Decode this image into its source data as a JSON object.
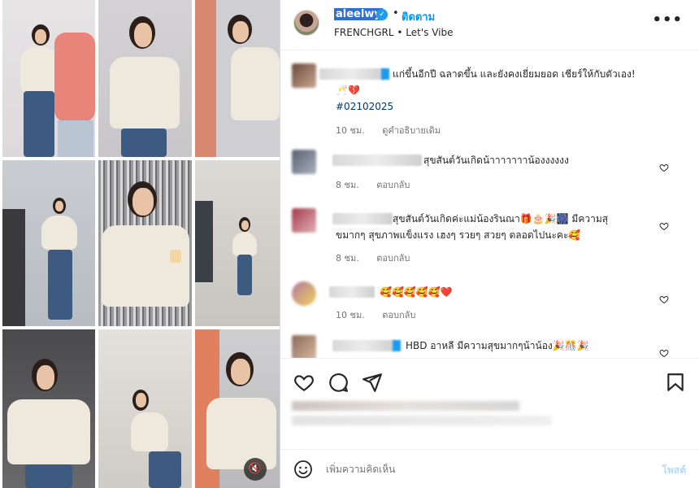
{
  "post": {
    "username": "aleelwy",
    "follow_label": "ติดตาม",
    "separator": "•",
    "brand": "FRENCHGRL",
    "song": "Let's Vibe",
    "more_label": "•••"
  },
  "comments": [
    {
      "text": "แก่ขึ้นอีกปี ฉลาดขึ้น และยังคงเยี่ยมยอด เชียร์ให้กับตัวเอง!",
      "emoji": "🥂💔",
      "hashtag": "#02102025",
      "time": "10 ชม.",
      "action": "ดูคำอธิบายเดิม"
    },
    {
      "text": "สุขสันต์วันเกิดน้าาาาาาาน้องงงงงง",
      "time": "8 ชม.",
      "action": "ตอบกลับ"
    },
    {
      "text_line1": "สุขสันต์วันเกิดค่ะแม่น้องรินณา🎁🎂🎉🎆 มีความสุ",
      "text_line2": "ขมากๆ สุขภาพแข็งแรง เฮงๆ รวยๆ สวยๆ ตลอดไปนะคะ🥰",
      "time": "8 ชม.",
      "action": "ตอบกลับ"
    },
    {
      "text": "🥰🥰🥰🥰🥰❤️",
      "time": "10 ชม.",
      "action": "ตอบกลับ"
    },
    {
      "text": "HBD อาหลี มีความสุขมากๆน้าน้อง🎉🎊🎉"
    }
  ],
  "composer": {
    "placeholder": "เพิ่มความคิดเห็น",
    "post_label": "โพสต์"
  },
  "colors": {
    "accent": "#0095f6",
    "highlight": "#2d6fd6",
    "post_disabled": "#b3dbff"
  }
}
